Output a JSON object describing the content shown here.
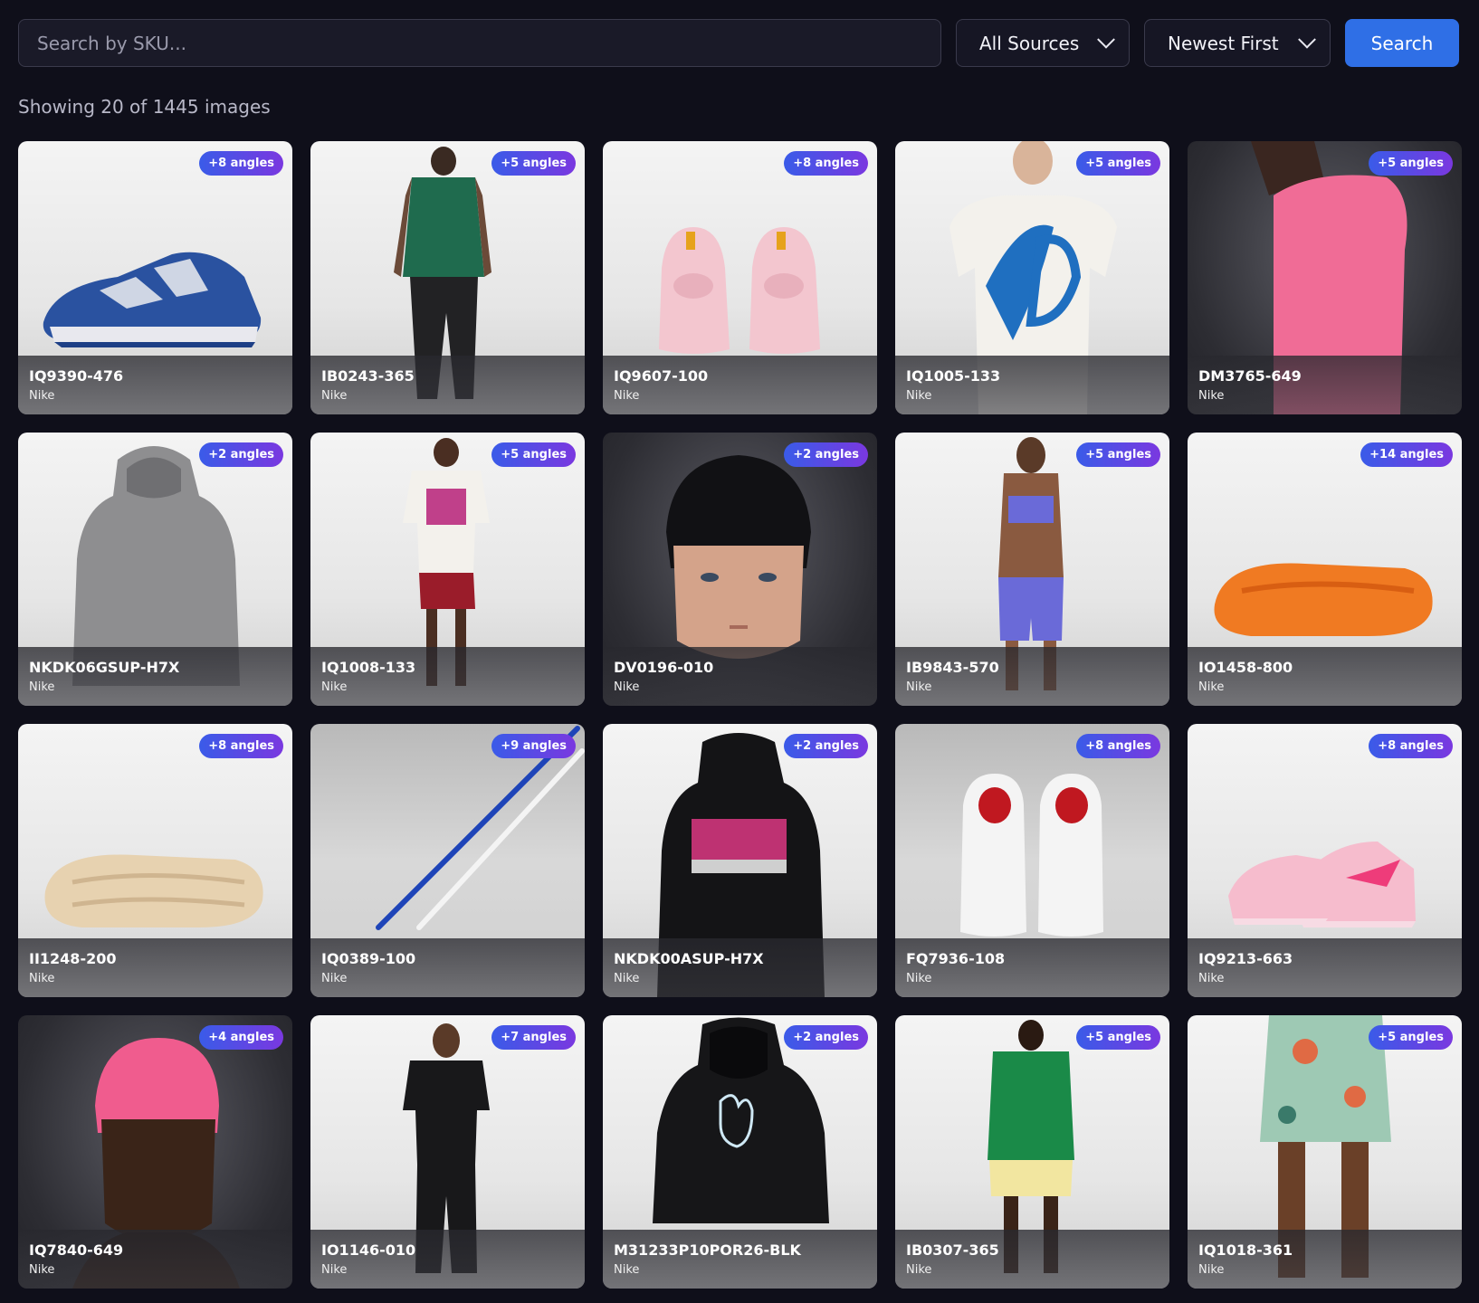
{
  "search": {
    "placeholder": "Search by SKU..."
  },
  "filters": {
    "source": "All Sources",
    "sort": "Newest First"
  },
  "search_button": "Search",
  "result_count": "Showing 20 of 1445 images",
  "items": [
    {
      "sku": "IQ9390-476",
      "brand": "Nike",
      "angles": "+8 angles"
    },
    {
      "sku": "IB0243-365",
      "brand": "Nike",
      "angles": "+5 angles"
    },
    {
      "sku": "IQ9607-100",
      "brand": "Nike",
      "angles": "+8 angles"
    },
    {
      "sku": "IQ1005-133",
      "brand": "Nike",
      "angles": "+5 angles"
    },
    {
      "sku": "DM3765-649",
      "brand": "Nike",
      "angles": "+5 angles"
    },
    {
      "sku": "NKDK06GSUP-H7X",
      "brand": "Nike",
      "angles": "+2 angles"
    },
    {
      "sku": "IQ1008-133",
      "brand": "Nike",
      "angles": "+5 angles"
    },
    {
      "sku": "DV0196-010",
      "brand": "Nike",
      "angles": "+2 angles"
    },
    {
      "sku": "IB9843-570",
      "brand": "Nike",
      "angles": "+5 angles"
    },
    {
      "sku": "IO1458-800",
      "brand": "Nike",
      "angles": "+14 angles"
    },
    {
      "sku": "II1248-200",
      "brand": "Nike",
      "angles": "+8 angles"
    },
    {
      "sku": "IQ0389-100",
      "brand": "Nike",
      "angles": "+9 angles"
    },
    {
      "sku": "NKDK00ASUP-H7X",
      "brand": "Nike",
      "angles": "+2 angles"
    },
    {
      "sku": "FQ7936-108",
      "brand": "Nike",
      "angles": "+8 angles"
    },
    {
      "sku": "IQ9213-663",
      "brand": "Nike",
      "angles": "+8 angles"
    },
    {
      "sku": "IQ7840-649",
      "brand": "Nike",
      "angles": "+4 angles"
    },
    {
      "sku": "IO1146-010",
      "brand": "Nike",
      "angles": "+7 angles"
    },
    {
      "sku": "M31233P10POR26-BLK",
      "brand": "Nike",
      "angles": "+2 angles"
    },
    {
      "sku": "IB0307-365",
      "brand": "Nike",
      "angles": "+5 angles"
    },
    {
      "sku": "IQ1018-361",
      "brand": "Nike",
      "angles": "+5 angles"
    }
  ]
}
